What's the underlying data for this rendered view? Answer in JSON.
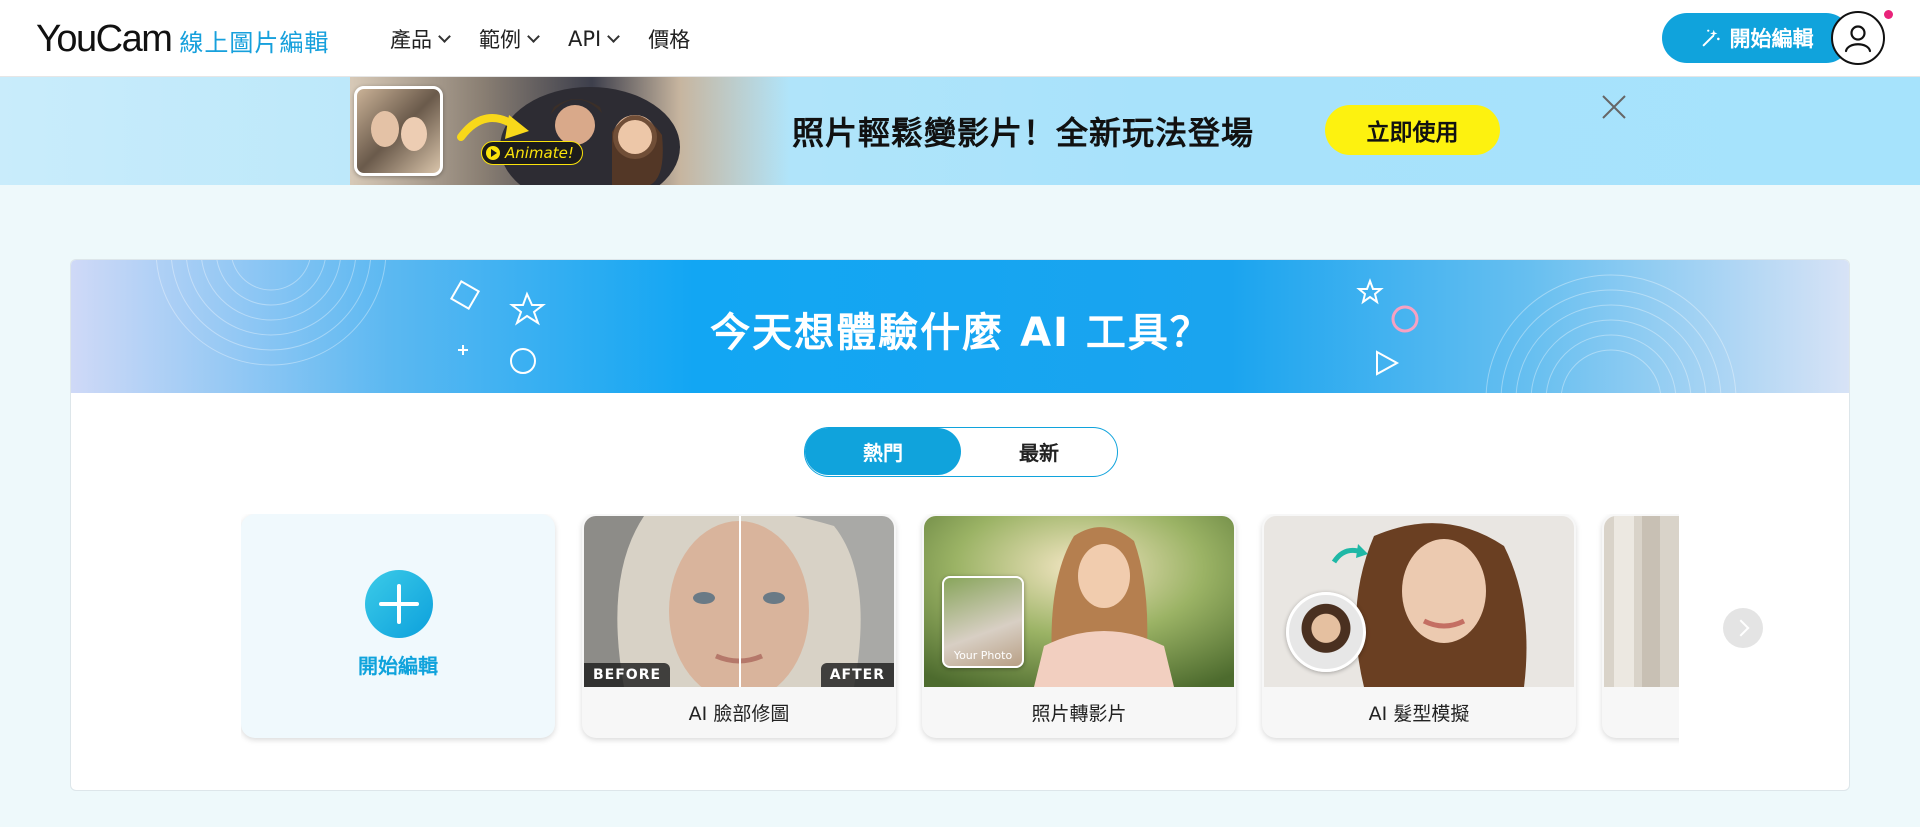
{
  "header": {
    "logo_main": "YouCam",
    "logo_sub": "線上圖片編輯",
    "nav": [
      {
        "label": "產品",
        "has_dropdown": true
      },
      {
        "label": "範例",
        "has_dropdown": true
      },
      {
        "label": "API",
        "has_dropdown": true
      },
      {
        "label": "價格",
        "has_dropdown": false
      }
    ],
    "start_button": "開始編輯",
    "accent_color": "#10a3dc",
    "notification_dot_color": "#e9237a"
  },
  "promo": {
    "badge": "Animate!",
    "text": "照片輕鬆變影片！全新玩法登場",
    "cta": "立即使用",
    "cta_color": "#fdf20f"
  },
  "tools": {
    "hero_title": "今天想體驗什麼 AI 工具？",
    "tabs": [
      {
        "label": "熱門",
        "active": true
      },
      {
        "label": "最新",
        "active": false
      }
    ],
    "add_card_label": "開始編輯",
    "cards": [
      {
        "label": "AI 臉部修圖",
        "before": "BEFORE",
        "after": "AFTER"
      },
      {
        "label": "照片轉影片",
        "overlay": "Your Photo"
      },
      {
        "label": "AI 髮型模擬"
      }
    ]
  }
}
